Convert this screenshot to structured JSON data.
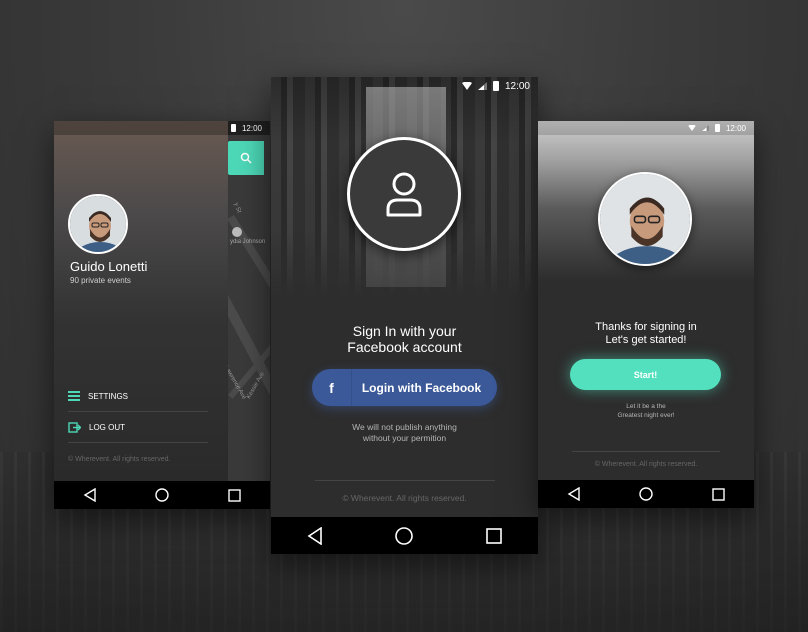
{
  "left_screen": {
    "status_time": "12:00",
    "map_labels": [
      "y St",
      "ydia Johnson",
      "Lawrence Ave",
      "Kessie Ave"
    ],
    "profile": {
      "name": "Guido Lonetti",
      "subtitle": "90 private events"
    },
    "menu": [
      {
        "label": "SETTINGS",
        "icon": "hamburger-icon"
      },
      {
        "label": "LOG OUT",
        "icon": "logout-icon"
      }
    ],
    "copyright": "© Wherevent. All rights reserved."
  },
  "center_screen": {
    "status_time": "12:00",
    "title_line1": "Sign In with your",
    "title_line2": "Facebook account",
    "facebook_button": {
      "icon": "f",
      "label": "Login with Facebook"
    },
    "note_line1": "We will not publish anything",
    "note_line2": "without your permition",
    "copyright": "© Wherevent. All rights reserved."
  },
  "right_screen": {
    "status_time": "12:00",
    "thanks_line1": "Thanks for signing in",
    "thanks_line2": "Let's get started!",
    "start_button": "Start!",
    "tagline_line1": "Let it be a the",
    "tagline_line2": "Greatest night ever!",
    "copyright": "© Wherevent. All rights reserved."
  },
  "colors": {
    "accent_teal": "#52e0be",
    "facebook_blue": "#3b5998",
    "nav_bar": "#000000"
  }
}
